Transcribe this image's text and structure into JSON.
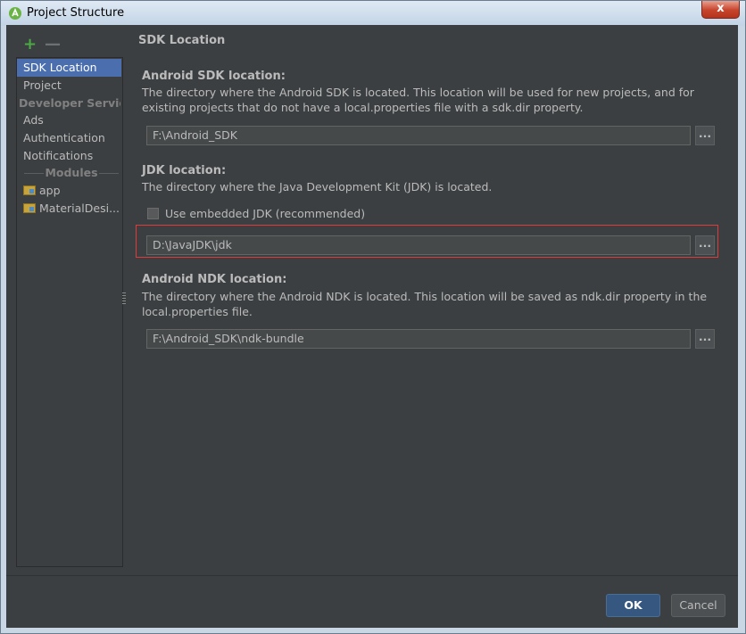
{
  "window": {
    "title": "Project Structure",
    "close_label": "x"
  },
  "sidebar": {
    "add_label": "+",
    "remove_label": "—",
    "items": [
      {
        "label": "SDK Location"
      },
      {
        "label": "Project"
      },
      {
        "label": "Developer Services"
      },
      {
        "label": "Ads"
      },
      {
        "label": "Authentication"
      },
      {
        "label": "Notifications"
      },
      {
        "label": "Modules"
      },
      {
        "label": "app"
      },
      {
        "label": "MaterialDesi..."
      }
    ]
  },
  "main": {
    "section_title": "SDK Location",
    "android_sdk": {
      "label": "Android SDK location:",
      "description": "The directory where the Android SDK is located. This location will be used for new projects, and for existing projects that do not have a local.properties file with a sdk.dir property.",
      "value": "F:\\Android_SDK",
      "browse_label": "..."
    },
    "jdk": {
      "label": "JDK location:",
      "description": "The directory where the Java Development Kit (JDK) is located.",
      "checkbox_label": "Use embedded JDK (recommended)",
      "checkbox_checked": false,
      "value": "D:\\JavaJDK\\jdk",
      "browse_label": "..."
    },
    "android_ndk": {
      "label": "Android NDK location:",
      "description": "The directory where the Android NDK is located. This location will be saved as ndk.dir property in the local.properties file.",
      "value": "F:\\Android_SDK\\ndk-bundle",
      "browse_label": "..."
    }
  },
  "footer": {
    "ok_label": "OK",
    "cancel_label": "Cancel"
  },
  "colors": {
    "background": "#3c3f41",
    "selection": "#4b6eaf",
    "accent_add": "#4ca844",
    "highlight_border": "#e03b3b",
    "ok_button": "#365880"
  }
}
